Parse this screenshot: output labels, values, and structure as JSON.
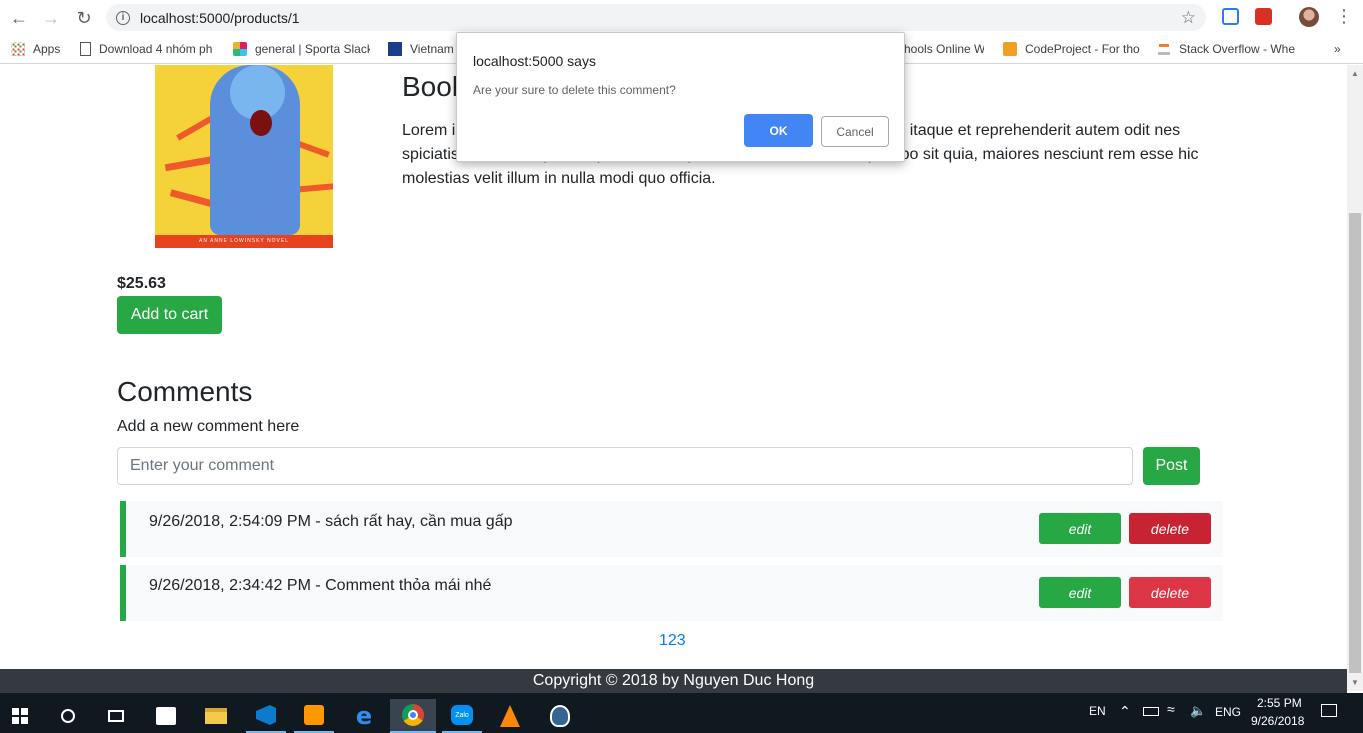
{
  "browser": {
    "url": "localhost:5000/products/1",
    "bookmarks": [
      {
        "label": "Apps",
        "icon": "apps-grid-icon"
      },
      {
        "label": "Download 4 nhóm ph",
        "icon": "document-icon"
      },
      {
        "label": "general | Sporta Slack",
        "icon": "slack-icon"
      },
      {
        "label": "Vietnam",
        "icon": "vns-icon"
      },
      {
        "label": "hools Online W",
        "icon": ""
      },
      {
        "label": "CodeProject - For tho",
        "icon": "codeproject-icon"
      },
      {
        "label": "Stack Overflow - Whe",
        "icon": "stackoverflow-icon"
      }
    ],
    "more_label": "»"
  },
  "product": {
    "title": "Book",
    "cover_band": "AN ANNE LOWINSKY NOVEL",
    "description": "Lorem i                                                                                    etur neque itaque et reprehenderit autem odit nes                                                                                  spiciatis, reiciendis ipsam, quo id consequatur. Delectus officiis explicabo sit quia, maiores nesciunt rem esse hic molestias velit illum in nulla modi quo officia.",
    "price": "$25.63",
    "add_to_cart": "Add to cart"
  },
  "comments": {
    "heading": "Comments",
    "add_label": "Add a new comment here",
    "input_placeholder": "Enter your comment",
    "post_label": "Post",
    "items": [
      {
        "text": "9/26/2018, 2:54:09 PM - sách rất hay, cần mua gấp",
        "edit": "edit",
        "delete": "delete"
      },
      {
        "text": "9/26/2018, 2:34:42 PM - Comment thỏa mái nhé",
        "edit": "edit",
        "delete": "delete"
      }
    ],
    "pagination": "123"
  },
  "footer": {
    "text": "Copyright © 2018 by Nguyen Duc Hong"
  },
  "dialog": {
    "title": "localhost:5000 says",
    "message": "Are your sure to delete this comment?",
    "ok": "OK",
    "cancel": "Cancel"
  },
  "taskbar": {
    "lang_short": "EN",
    "lang": "ENG",
    "time": "2:55 PM",
    "date": "9/26/2018",
    "apps": [
      "start-icon",
      "cortana-icon",
      "task-view-icon",
      "store-icon",
      "file-explorer-icon",
      "vscode-icon",
      "sublime-icon",
      "edge-icon",
      "chrome-icon",
      "zalo-icon",
      "vlc-icon",
      "postgres-icon"
    ]
  },
  "colors": {
    "success": "#28a745",
    "danger": "#dc3545",
    "link": "#007bff",
    "footer_bg": "#343a40",
    "dialog_ok": "#4285f4"
  }
}
